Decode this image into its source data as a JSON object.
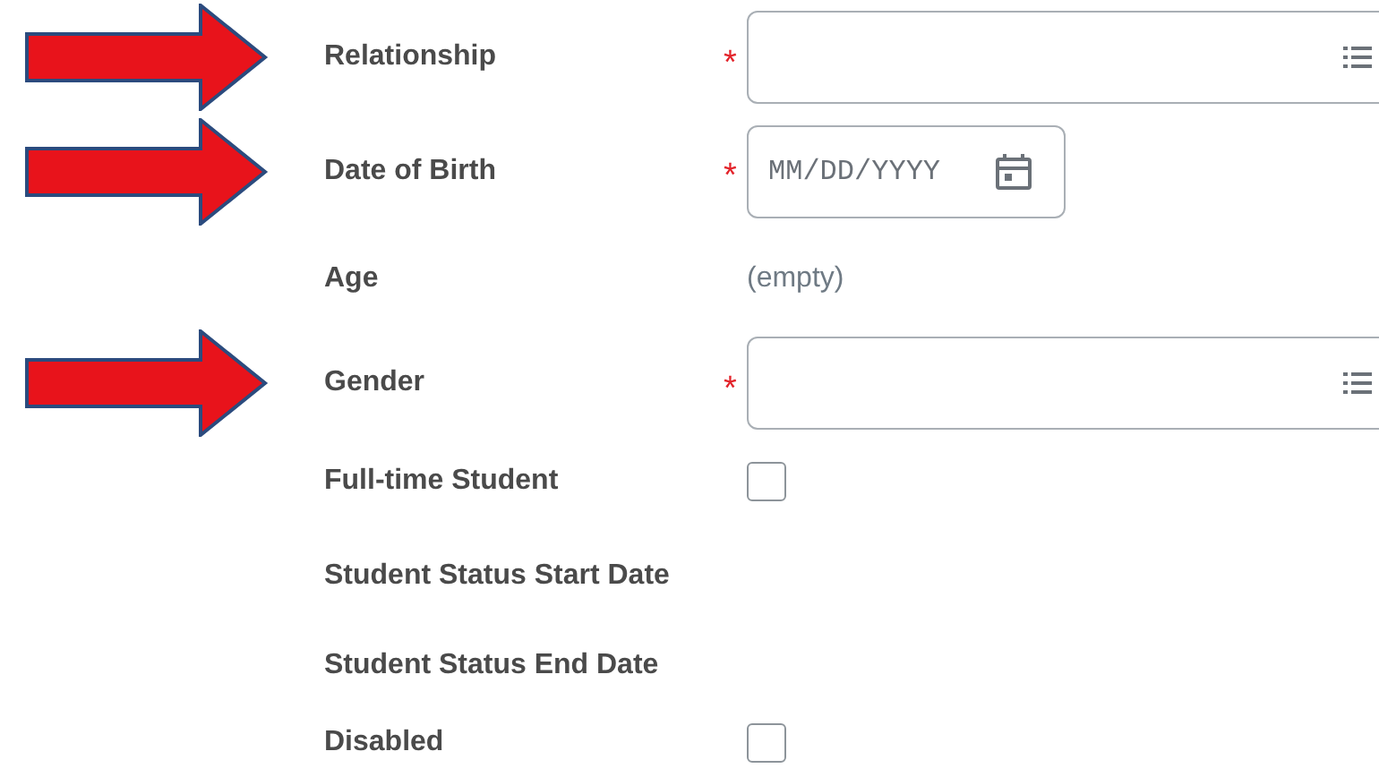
{
  "required_mark": "*",
  "fields": [
    {
      "label": "Relationship",
      "required": true,
      "annotated": true,
      "kind": "select"
    },
    {
      "label": "Date of Birth",
      "required": true,
      "annotated": true,
      "kind": "date",
      "placeholder": "MM/DD/YYYY"
    },
    {
      "label": "Age",
      "required": false,
      "annotated": false,
      "kind": "readonly",
      "value": "(empty)"
    },
    {
      "label": "Gender",
      "required": true,
      "annotated": true,
      "kind": "select"
    },
    {
      "label": "Full-time Student",
      "required": false,
      "annotated": false,
      "kind": "checkbox",
      "checked": false
    },
    {
      "label": "Student Status Start Date",
      "required": false,
      "annotated": false,
      "kind": "none"
    },
    {
      "label": "Student Status End Date",
      "required": false,
      "annotated": false,
      "kind": "none"
    },
    {
      "label": "Disabled",
      "required": false,
      "annotated": false,
      "kind": "checkbox",
      "checked": false
    }
  ]
}
